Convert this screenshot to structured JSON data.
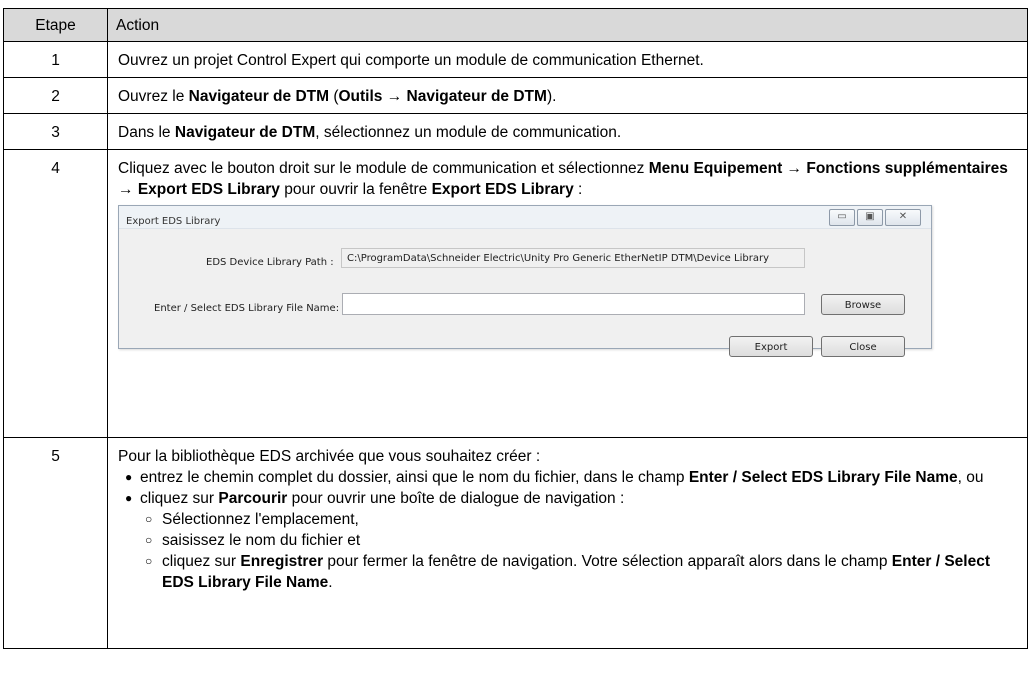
{
  "table": {
    "header_step": "Etape",
    "header_action": "Action"
  },
  "steps": [
    {
      "num": "1",
      "text": "Ouvrez un projet Control Expert qui comporte un module de communication Ethernet."
    },
    {
      "num": "2",
      "t1": "Ouvrez le ",
      "b1": "Navigateur de DTM",
      "t2": " (",
      "b2": "Outils",
      "arrow": " → ",
      "b3": "Navigateur de DTM",
      "t3": ")."
    },
    {
      "num": "3",
      "t1": "Dans le ",
      "b1": "Navigateur de DTM",
      "t2": ", sélectionnez un module de communication."
    },
    {
      "num": "4",
      "t1": "Cliquez avec le bouton droit sur le module de communication et sélectionnez ",
      "b1": "Menu Equipement",
      "arrow1": " → ",
      "b2": "Fonctions supplémentaires",
      "arrow2": " → ",
      "b3": "Export EDS Library",
      "t2": " pour ouvrir la fenêtre ",
      "b4": "Export EDS Library",
      "t3": " :"
    },
    {
      "num": "5",
      "intro": "Pour la bibliothèque EDS archivée que vous souhaitez créer :",
      "bullet1_t1": "entrez le chemin complet du dossier, ainsi que le nom du fichier, dans le champ ",
      "bullet1_b1": "Enter / Select EDS Library File Name",
      "bullet1_t2": ", ou",
      "bullet2_t1": "cliquez sur ",
      "bullet2_b1": "Parcourir",
      "bullet2_t2": " pour ouvrir une boîte de dialogue de navigation :",
      "sub1": "Sélectionnez l'emplacement,",
      "sub2": "saisissez le nom du fichier et",
      "sub3_t1": "cliquez sur ",
      "sub3_b1": "Enregistrer",
      "sub3_t2": " pour fermer la fenêtre de navigation. Votre sélection apparaît alors dans le champ ",
      "sub3_b2": "Enter / Select EDS Library File Name",
      "sub3_t3": "."
    }
  ],
  "dialog": {
    "title": "Export EDS Library",
    "minimize_glyph": "▭",
    "maximize_glyph": "▣",
    "close_glyph": "✕",
    "path_label": "EDS Device Library Path :",
    "path_value": "C:\\ProgramData\\Schneider Electric\\Unity Pro Generic EtherNetIP DTM\\Device Library",
    "name_label": "Enter / Select EDS Library File Name:",
    "name_value": "",
    "browse_label": "Browse",
    "export_label": "Export",
    "close_label": "Close"
  }
}
